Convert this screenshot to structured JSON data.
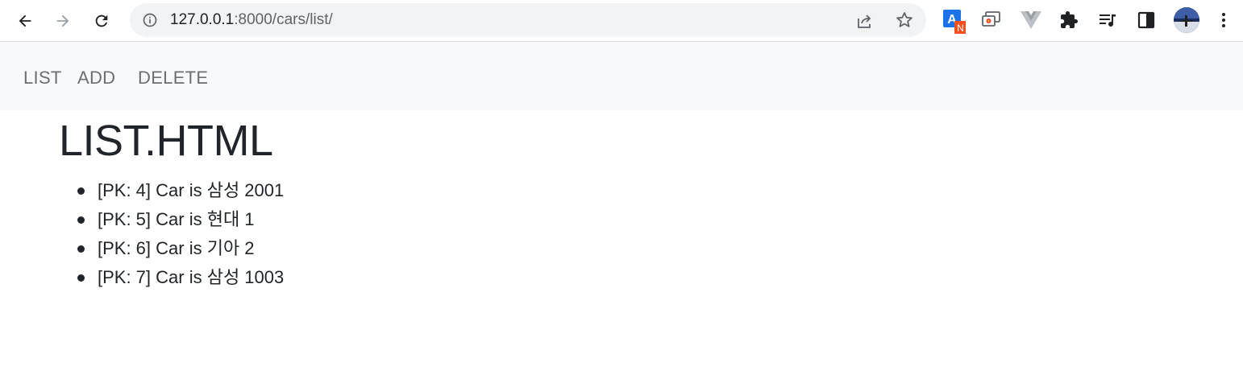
{
  "browser": {
    "url_host": "127.0.0.1",
    "url_rest": ":8000/cars/list/",
    "back_icon": "back-arrow-icon",
    "forward_icon": "forward-arrow-icon",
    "reload_icon": "reload-icon",
    "extension_badge": "N"
  },
  "navbar": {
    "links": [
      "LIST",
      "ADD",
      "DELETE"
    ]
  },
  "page": {
    "title": "LIST.HTML"
  },
  "cars": [
    "[PK: 4] Car is 삼성 2001",
    "[PK: 5] Car is 현대 1",
    "[PK: 6] Car is 기아 2",
    "[PK: 7] Car is 삼성 1003"
  ],
  "colors": {
    "nav_bg": "#f8f9fa",
    "nav_link": "#6c6e70",
    "text": "#212529",
    "omnibox_bg": "#f1f3f4"
  }
}
